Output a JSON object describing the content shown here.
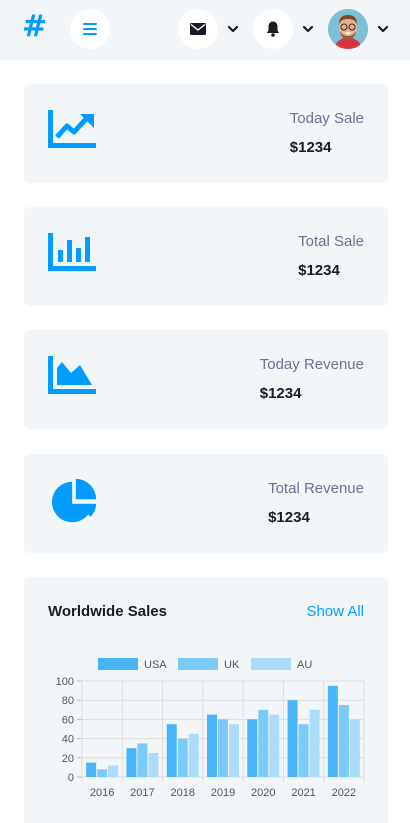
{
  "topbar": {
    "brand": "#",
    "icons": [
      "bars-icon",
      "envelope-icon",
      "bell-icon",
      "avatar"
    ]
  },
  "cards": [
    {
      "label": "Today Sale",
      "value": "$1234",
      "icon": "chart-line-icon"
    },
    {
      "label": "Total Sale",
      "value": "$1234",
      "icon": "chart-bar-icon"
    },
    {
      "label": "Today Revenue",
      "value": "$1234",
      "icon": "chart-area-icon"
    },
    {
      "label": "Total Revenue",
      "value": "$1234",
      "icon": "chart-pie-icon"
    }
  ],
  "sales_panel": {
    "title": "Worldwide Sales",
    "show_all": "Show All"
  },
  "colors": {
    "accent": "#009cff",
    "usa": "#49b4f7",
    "uk": "#7ccaf9",
    "au": "#abdcfb"
  },
  "chart_data": {
    "type": "bar",
    "categories": [
      "2016",
      "2017",
      "2018",
      "2019",
      "2020",
      "2021",
      "2022"
    ],
    "series": [
      {
        "name": "USA",
        "values": [
          15,
          30,
          55,
          65,
          60,
          80,
          95
        ]
      },
      {
        "name": "UK",
        "values": [
          8,
          35,
          40,
          60,
          70,
          55,
          75
        ]
      },
      {
        "name": "AU",
        "values": [
          12,
          25,
          45,
          55,
          65,
          70,
          60
        ]
      }
    ],
    "ylim": [
      0,
      100
    ],
    "yticks": [
      0,
      20,
      40,
      60,
      80,
      100
    ],
    "grid": true,
    "legend": "top"
  }
}
